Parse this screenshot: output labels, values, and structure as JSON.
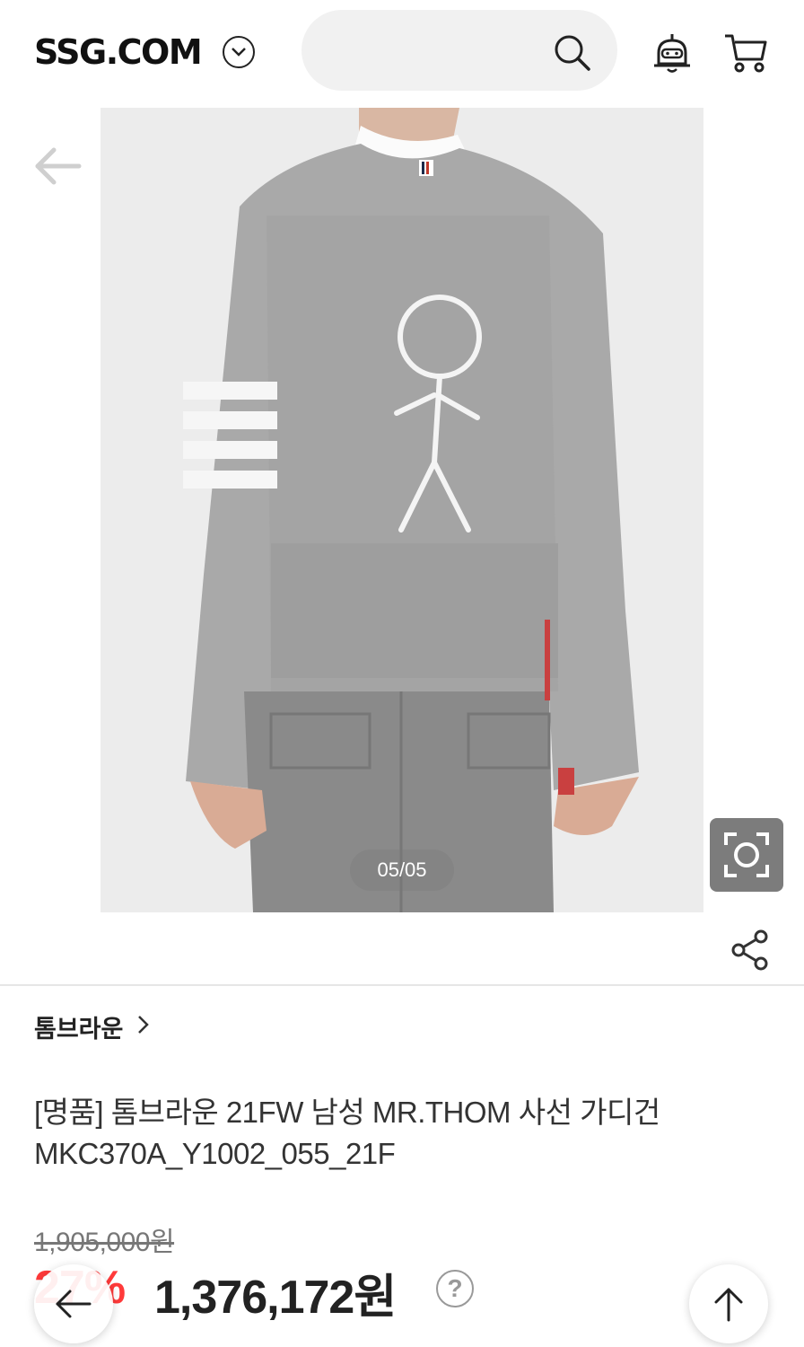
{
  "header": {
    "logo": "SSG.COM",
    "search_placeholder": "",
    "icons": [
      "chevron-down-icon",
      "search-icon",
      "chatbot-icon",
      "cart-icon"
    ]
  },
  "gallery": {
    "counter": "05/05",
    "icons": [
      "back-arrow-icon",
      "camera-lens-icon",
      "share-icon"
    ]
  },
  "product": {
    "brand": "톰브라운",
    "title": "[명품] 톰브라운 21FW 남성 MR.THOM 사선 가디건 MKC370A_Y1002_055_21F",
    "original_price": "1,905,000원",
    "discount": "27%",
    "sale_price": "1,376,172원",
    "help": "?"
  },
  "colors": {
    "discount": "#ff3a3a",
    "text": "#222222",
    "search_bg": "#f1f1f1"
  }
}
